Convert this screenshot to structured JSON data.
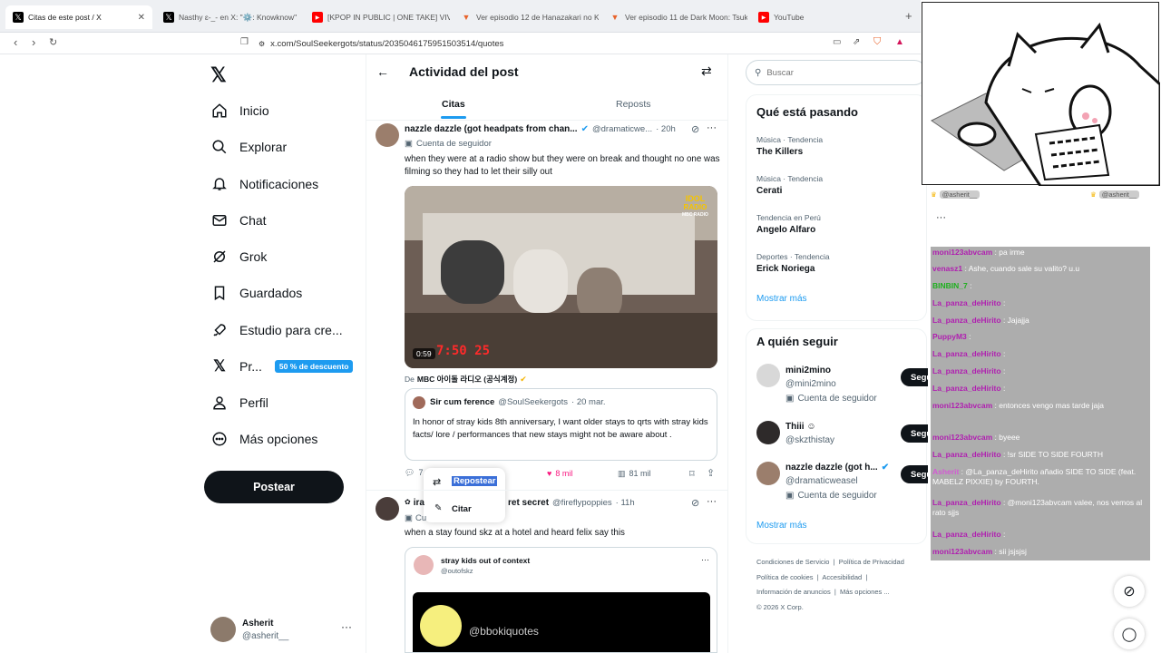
{
  "browser": {
    "tabs": [
      {
        "label": "Citas de este post / X",
        "icon": "x-logo-icon",
        "active": true
      },
      {
        "label": "Nasthy ɛ-_- en X: \"⚙️: Knowknow\"",
        "icon": "x-logo-icon",
        "active": false
      },
      {
        "label": "[KPOP IN PUBLIC | ONE TAKE] VIVIZ",
        "icon": "youtube-icon",
        "active": false
      },
      {
        "label": "Ver episodio 12 de Hanazakari no Ki",
        "icon": "anime-icon",
        "active": false
      },
      {
        "label": "Ver episodio 11 de Dark Moon: Tsuki",
        "icon": "anime-icon",
        "active": false
      },
      {
        "label": "YouTube",
        "icon": "youtube-icon",
        "active": false
      }
    ],
    "url": "x.com/SoulSeekergots/status/2035046175951503514/quotes"
  },
  "sidebar": {
    "items": [
      {
        "label": "Inicio",
        "icon": "home-icon"
      },
      {
        "label": "Explorar",
        "icon": "search-icon"
      },
      {
        "label": "Notificaciones",
        "icon": "bell-icon"
      },
      {
        "label": "Chat",
        "icon": "mail-icon"
      },
      {
        "label": "Grok",
        "icon": "grok-icon"
      },
      {
        "label": "Guardados",
        "icon": "bookmark-icon"
      },
      {
        "label": "Estudio para cre...",
        "icon": "rocket-icon"
      },
      {
        "label": "Pr...",
        "icon": "x-logo-icon"
      },
      {
        "label": "Perfil",
        "icon": "person-icon"
      },
      {
        "label": "Más opciones",
        "icon": "more-circle-icon"
      }
    ],
    "premium_badge": "50 % de descuento",
    "post_button": "Postear",
    "account": {
      "name": "Asherit",
      "handle": "@asherit__"
    }
  },
  "main": {
    "title": "Actividad del post",
    "tabs": [
      {
        "label": "Citas"
      },
      {
        "label": "Reposts"
      }
    ],
    "tweet1": {
      "name": "nazzle dazzle (got headpats from chan...",
      "handle": "@dramaticwe...",
      "time": "· 20h",
      "subtitle": "Cuenta de seguidor",
      "text": "when they were at a radio show but they were on break and thought no one was filming so they had to let their silly out",
      "video_duration": "0:59",
      "video_clock": "7:50 25",
      "video_logo_top": "IDOL",
      "video_logo_mid": "RADIO",
      "video_logo_bot": "MBC RADIO",
      "from_prefix": "De",
      "from_source": "MBC 아이돌 라디오 (공식계정)",
      "quoted": {
        "name": "Sir cum ference",
        "handle": "@SoulSeekergots",
        "time": "· 20 mar.",
        "text": "In honor of stray kids 8th anniversary, I want older stays to qrts with stray kids facts/ lore / performances that new stays might not be aware about ."
      },
      "replies": "7",
      "likes": "8 mil",
      "views": "81 mil"
    },
    "repost_menu": {
      "repost": "Repostear",
      "quote": "Citar"
    },
    "tweet2": {
      "name_start": "ira",
      "name_end": "ret secret",
      "handle": "@fireflypoppies",
      "time": "· 11h",
      "subtitle_start": "Cu",
      "text": "when a stay found skz at a hotel and heard felix say this",
      "quoted_name": "stray kids out of context",
      "quoted_handle": "@outofskz",
      "inner_handle": "@bbokiquotes"
    }
  },
  "right": {
    "search_placeholder": "Buscar",
    "trends_title": "Qué está pasando",
    "trends": [
      {
        "category": "Música · Tendencia",
        "name": "The Killers"
      },
      {
        "category": "Música · Tendencia",
        "name": "Cerati"
      },
      {
        "category": "Tendencia en Perú",
        "name": "Angelo Alfaro"
      },
      {
        "category": "Deportes · Tendencia",
        "name": "Erick Noriega"
      }
    ],
    "show_more": "Mostrar más",
    "follow_title": "A quién seguir",
    "follow": [
      {
        "name": "mini2mino",
        "handle": "@mini2mino",
        "extra": "Cuenta de seguidor"
      },
      {
        "name": "Thiii ☺",
        "handle": "@skzthistay",
        "extra": ""
      },
      {
        "name": "nazzle dazzle (got h...",
        "handle": "@dramaticweasel",
        "extra": "Cuenta de seguidor"
      }
    ],
    "follow_button": "Segui",
    "show_more_2": "Mostrar más",
    "footer": [
      "Condiciones de Servicio",
      "Política de Privacidad",
      "Política de cookies",
      "Accesibilidad",
      "Información de anuncios",
      "Más opciones ...",
      "© 2026 X Corp."
    ]
  },
  "stream": {
    "badge_left": "@asherit__",
    "badge_right": "@asherit__",
    "chat": [
      {
        "user": "moni123abvcam",
        "text": ": pa irme"
      },
      {
        "user": "venasz1",
        "text": ": Ashe, cuando sale su valito? u.u"
      },
      {
        "user": "BINBIN_7",
        "text": ":"
      },
      {
        "user": "La_panza_deHirito",
        "text": ":"
      },
      {
        "user": "La_panza_deHirito",
        "text": ": Jajajja"
      },
      {
        "user": "PuppyM3",
        "text": ":"
      },
      {
        "user": "La_panza_deHirito",
        "text": ":"
      },
      {
        "user": "La_panza_deHirito",
        "text": ":"
      },
      {
        "user": "La_panza_deHirito",
        "text": ":"
      },
      {
        "user": "moni123abvcam",
        "text": ": entonces vengo mas tarde jaja"
      },
      {
        "user": "moni123abvcam",
        "text": ": byeee"
      },
      {
        "user": "La_panza_deHirito",
        "text": ": !sr SIDE TO SIDE FOURTH"
      },
      {
        "user": "Asherit",
        "text": ": @La_panza_deHirito añadio SIDE TO SIDE (feat. MABELZ PIXXIE) by FOURTH."
      },
      {
        "user": "La_panza_deHirito",
        "text": ": @moni123abvcam valee, nos vemos al rato sjjs"
      },
      {
        "user": "La_panza_deHirito",
        "text": ":"
      },
      {
        "user": "moni123abvcam",
        "text": ": sii jsjsjsj"
      }
    ]
  },
  "colors": {
    "accent": "#1d9bf0",
    "text": "#0f1419",
    "muted": "#536471",
    "like": "#f91880",
    "chat_user": "#b01fb0"
  }
}
